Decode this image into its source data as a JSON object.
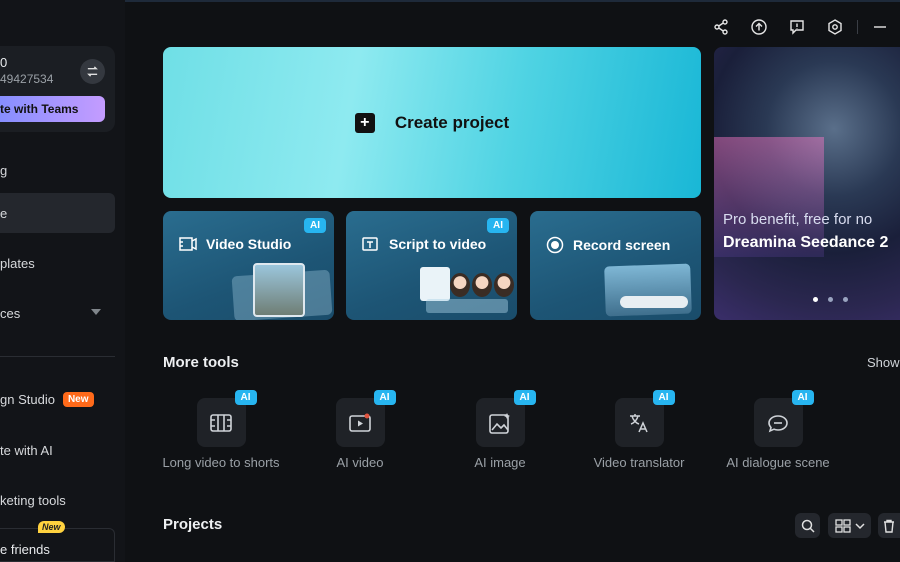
{
  "sidebar": {
    "account_name": "0",
    "account_id": "49427534",
    "teams_button": "te with Teams",
    "items": [
      {
        "label": "g"
      },
      {
        "label": "e"
      },
      {
        "label": "plates"
      },
      {
        "label": "ces"
      },
      {
        "label": "gn Studio",
        "badge": "New"
      },
      {
        "label": "te with AI"
      },
      {
        "label": "keting tools"
      }
    ],
    "invite_label": "e friends",
    "invite_badge": "New"
  },
  "topbar": {
    "icons": [
      "share-icon",
      "upload-icon",
      "feedback-icon",
      "settings-hex-icon",
      "minimize-icon"
    ]
  },
  "create": {
    "label": "Create project"
  },
  "features": [
    {
      "title": "Video Studio",
      "badge": "AI"
    },
    {
      "title": "Script to video",
      "badge": "AI"
    },
    {
      "title": "Record screen"
    }
  ],
  "banner": {
    "subtitle": "Pro benefit, free for no",
    "title": "Dreamina Seedance 2"
  },
  "more_tools": {
    "heading": "More tools",
    "show_all": "Show",
    "tools": [
      {
        "label": "Long video to shorts",
        "badge": "AI"
      },
      {
        "label": "AI video",
        "badge": "AI"
      },
      {
        "label": "AI image",
        "badge": "AI"
      },
      {
        "label": "Video translator",
        "badge": "AI"
      },
      {
        "label": "AI dialogue scene",
        "badge": "AI"
      }
    ]
  },
  "projects": {
    "heading": "Projects"
  },
  "colors": {
    "background": "#0f1114",
    "accent": "#27b5f0",
    "create_card": "#4fd3e3",
    "new_badge": "#ff6a1a"
  }
}
